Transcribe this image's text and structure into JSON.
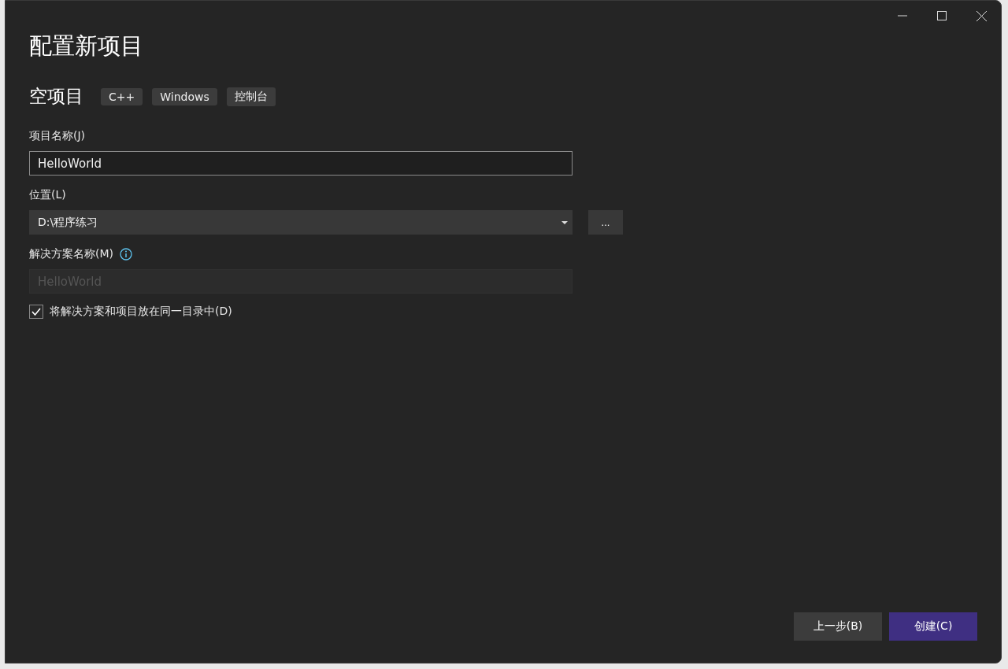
{
  "window": {
    "title": "配置新项目"
  },
  "template": {
    "name": "空项目",
    "tags": [
      "C++",
      "Windows",
      "控制台"
    ]
  },
  "fields": [
    {
      "kind": "text",
      "label": "项目名称(J)",
      "value": "HelloWorld"
    },
    {
      "kind": "dropdown",
      "label": "位置(L)",
      "value": "D:\\程序练习",
      "browse": "..."
    },
    {
      "kind": "text",
      "label": "解决方案名称(M)",
      "value": "HelloWorld",
      "disabled": true,
      "info": true
    }
  ],
  "checkbox": {
    "label": "将解决方案和项目放在同一目录中(D)",
    "checked": true
  },
  "buttons": [
    {
      "label": "上一步(B)",
      "primary": false
    },
    {
      "label": "创建(C)",
      "primary": true
    }
  ]
}
